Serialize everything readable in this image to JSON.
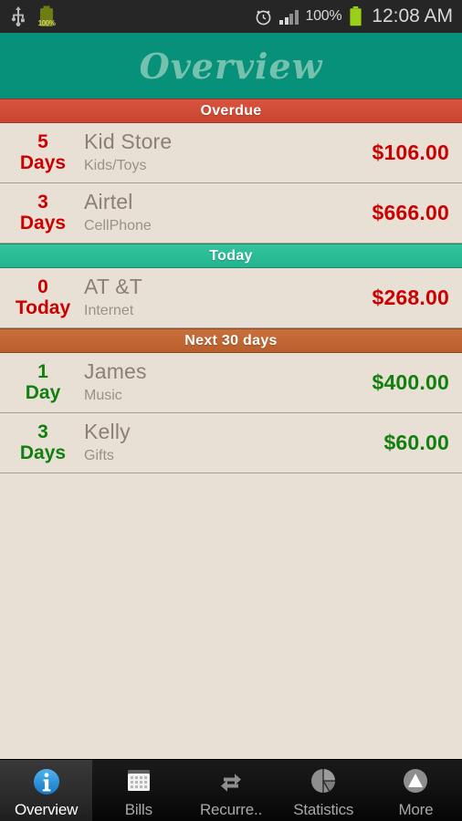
{
  "status_bar": {
    "usb_icon": "usb-icon",
    "battery_left_label": "100%",
    "alarm_icon": "alarm-clock-icon",
    "signal_icon": "signal-bars-icon",
    "battery_percent": "100%",
    "battery_icon": "battery-full-icon",
    "clock": "12:08 AM"
  },
  "header": {
    "title": "Overview",
    "bg_color": "#07907a",
    "text_color": "#74c1ad"
  },
  "sections": [
    {
      "label": "Overdue",
      "color": "#d8543f",
      "style": "overdue",
      "amount_color": "red",
      "days_color": "red",
      "items": [
        {
          "days_num": "5",
          "days_unit": "Days",
          "name": "Kid Store",
          "category": "Kids/Toys",
          "amount": "$106.00"
        },
        {
          "days_num": "3",
          "days_unit": "Days",
          "name": "Airtel",
          "category": "CellPhone",
          "amount": "$666.00"
        }
      ]
    },
    {
      "label": "Today",
      "color": "#31c49d",
      "style": "today",
      "amount_color": "red",
      "days_color": "red",
      "items": [
        {
          "days_num": "0",
          "days_unit": "Today",
          "name": "AT &T",
          "category": "Internet",
          "amount": "$268.00"
        }
      ]
    },
    {
      "label": "Next 30 days",
      "color": "#c96f3b",
      "style": "next",
      "amount_color": "green",
      "days_color": "green",
      "items": [
        {
          "days_num": "1",
          "days_unit": "Day",
          "name": "James",
          "category": "Music",
          "amount": "$400.00"
        },
        {
          "days_num": "3",
          "days_unit": "Days",
          "name": "Kelly",
          "category": "Gifts",
          "amount": "$60.00"
        }
      ]
    }
  ],
  "tabs": [
    {
      "label": "Overview",
      "icon": "info-circle-icon",
      "selected": true
    },
    {
      "label": "Bills",
      "icon": "calendar-icon",
      "selected": false
    },
    {
      "label": "Recurre..",
      "icon": "repeat-arrows-icon",
      "selected": false
    },
    {
      "label": "Statistics",
      "icon": "pie-chart-icon",
      "selected": false
    },
    {
      "label": "More",
      "icon": "triangle-up-icon",
      "selected": false
    }
  ],
  "theme": {
    "page_bg": "#e8e0d5",
    "row_separator": "#a79e92",
    "name_text": "#8a8078",
    "category_text": "#9a9188",
    "red": "#cc0000",
    "green": "#118011"
  }
}
